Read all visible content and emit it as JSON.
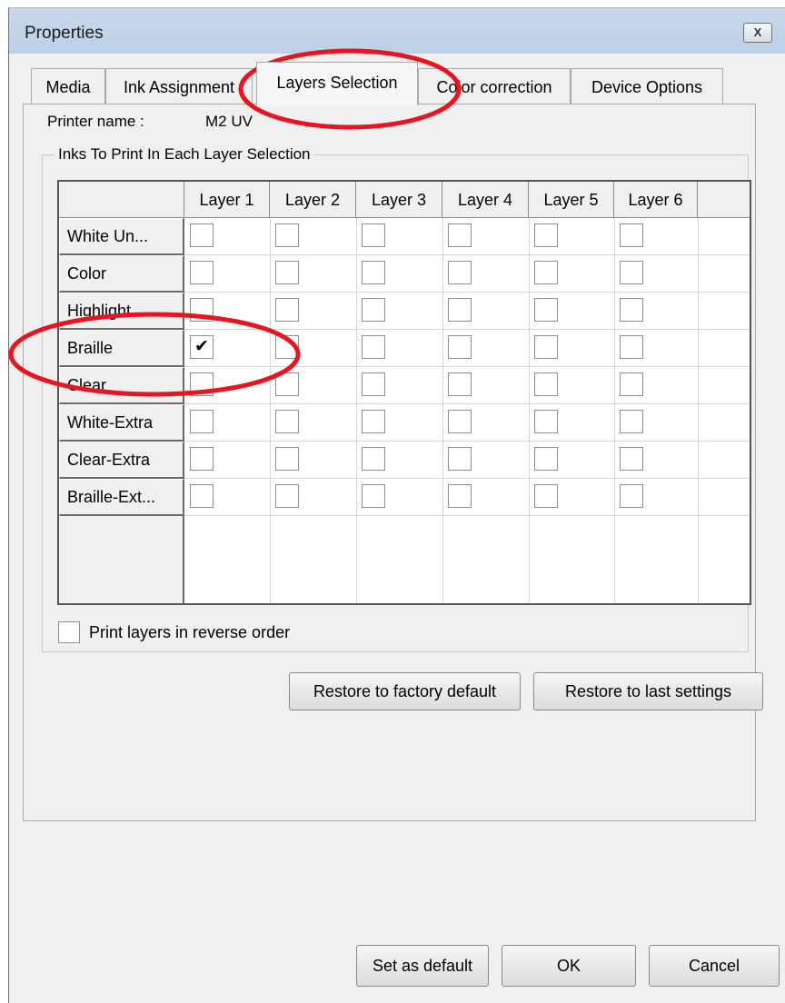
{
  "window": {
    "title": "Properties",
    "close_glyph": "X"
  },
  "tabs": [
    {
      "label": "Media",
      "active": false
    },
    {
      "label": "Ink Assignment",
      "active": false
    },
    {
      "label": "Layers Selection",
      "active": true
    },
    {
      "label": "Color correction",
      "active": false
    },
    {
      "label": "Device Options",
      "active": false
    }
  ],
  "printer": {
    "label": "Printer name :",
    "value": "M2 UV"
  },
  "group": {
    "title": "Inks To Print In Each Layer Selection"
  },
  "grid": {
    "columns": [
      "Layer 1",
      "Layer 2",
      "Layer 3",
      "Layer 4",
      "Layer 5",
      "Layer 6"
    ],
    "rows": [
      {
        "label": "White Un...",
        "checked": [
          false,
          false,
          false,
          false,
          false,
          false
        ]
      },
      {
        "label": "Color",
        "checked": [
          false,
          false,
          false,
          false,
          false,
          false
        ]
      },
      {
        "label": "Highlight",
        "checked": [
          false,
          false,
          false,
          false,
          false,
          false
        ]
      },
      {
        "label": "Braille",
        "checked": [
          true,
          false,
          false,
          false,
          false,
          false
        ]
      },
      {
        "label": "Clear",
        "checked": [
          false,
          false,
          false,
          false,
          false,
          false
        ]
      },
      {
        "label": "White-Extra",
        "checked": [
          false,
          false,
          false,
          false,
          false,
          false
        ]
      },
      {
        "label": "Clear-Extra",
        "checked": [
          false,
          false,
          false,
          false,
          false,
          false
        ]
      },
      {
        "label": "Braille-Ext...",
        "checked": [
          false,
          false,
          false,
          false,
          false,
          false
        ]
      }
    ],
    "check_glyph": "✔"
  },
  "reverse_order": {
    "label": "Print layers in reverse order",
    "checked": false
  },
  "buttons": {
    "restore_factory": "Restore to factory default",
    "restore_last": "Restore to last settings",
    "set_default": "Set as default",
    "ok": "OK",
    "cancel": "Cancel"
  },
  "annotation_color": "#e8141f"
}
